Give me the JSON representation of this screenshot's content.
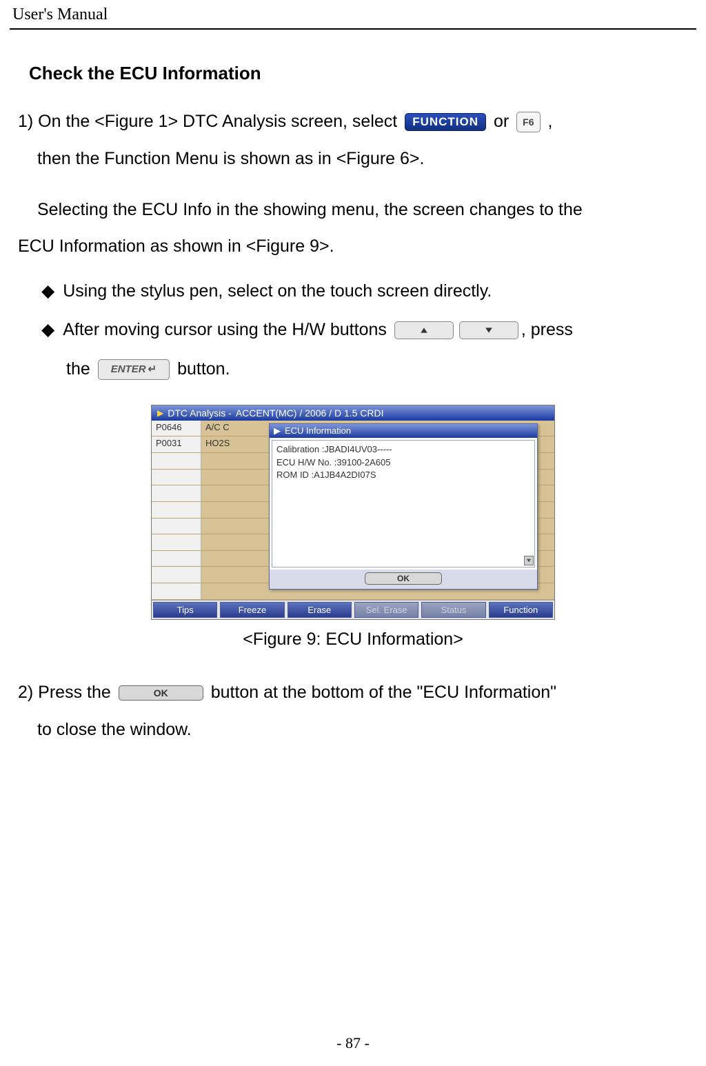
{
  "header": {
    "title": "User's Manual"
  },
  "section": {
    "heading": "Check the ECU Information"
  },
  "step1": {
    "line1_pre": "1) On the <Figure 1> DTC Analysis screen, select ",
    "function_btn": "FUNCTION",
    "or_text": " or ",
    "f6_btn": "F6",
    "line1_post": ",",
    "line2": "then the Function Menu is shown as in <Figure 6>."
  },
  "para2": {
    "line1": "Selecting the ECU Info in the showing menu, the screen changes to the",
    "line2": "ECU Information as shown in <Figure 9>."
  },
  "bullets": {
    "b1": "Using the stylus pen, select on the touch screen directly.",
    "b2_pre": "After moving cursor using the H/W buttons ",
    "b2_post": ", press",
    "b2_line2_pre": "the ",
    "enter_label": "ENTER",
    "b2_line2_post": " button."
  },
  "screenshot": {
    "title_prefix": "DTC Analysis - ",
    "title_vehicle": "ACCENT(MC) / 2006 / D 1.5 CRDI",
    "dtc_rows": [
      {
        "code": "P0646",
        "desc": "A/C C"
      },
      {
        "code": "P0031",
        "desc": "HO2S"
      }
    ],
    "popup": {
      "title": "ECU Information",
      "lines": [
        "Calibration :JBADI4UV03-----",
        "ECU H/W No. :39100-2A605",
        "ROM ID :A1JB4A2DI07S"
      ],
      "ok": "OK"
    },
    "toolbar": {
      "tips": "Tips",
      "freeze": "Freeze",
      "erase": "Erase",
      "sel_erase": "Sel. Erase",
      "status": "Status",
      "function": "Function"
    }
  },
  "figure_caption": "<Figure 9: ECU Information>",
  "step2": {
    "pre": "2) Press the ",
    "ok_btn": "OK",
    "mid": " button at the bottom of the \"ECU Information\"",
    "line2": "to close the window."
  },
  "page_number": "- 87 -"
}
